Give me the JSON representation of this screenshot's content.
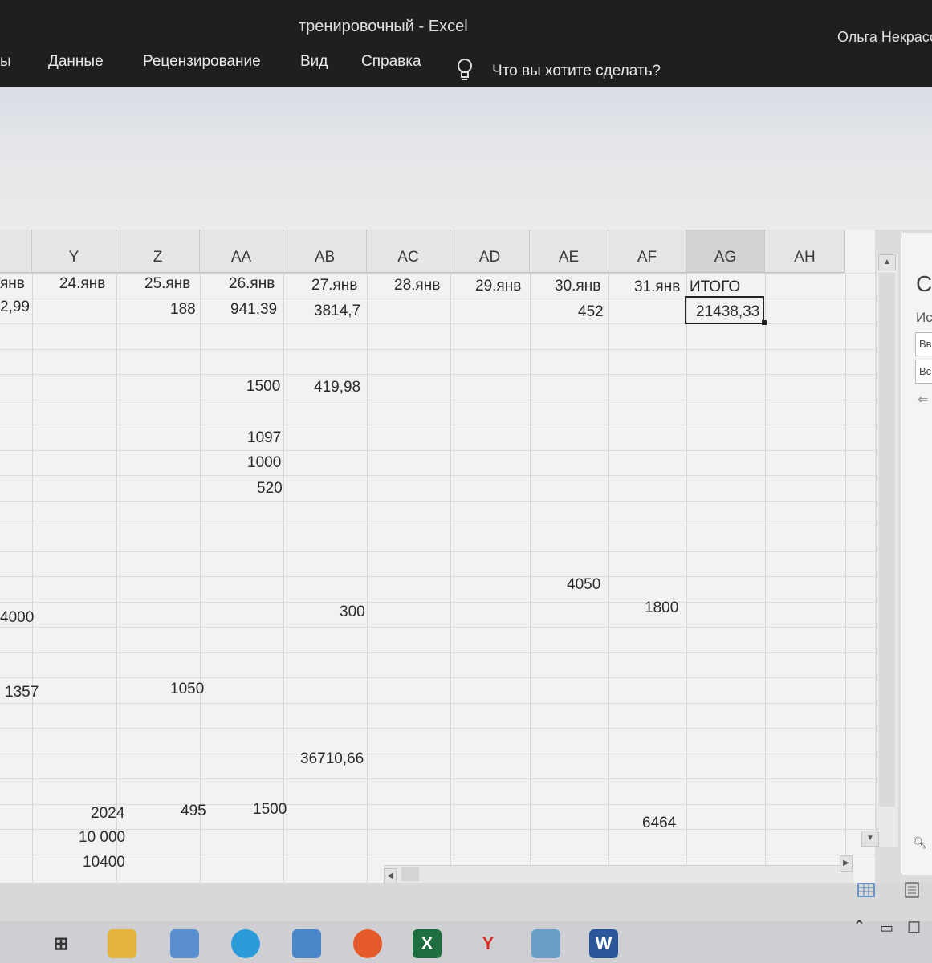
{
  "window": {
    "title": "тренировочный - Excel",
    "user": "Ольга Некрасо"
  },
  "ribbon_tabs": [
    {
      "label": "ы"
    },
    {
      "label": "Данные"
    },
    {
      "label": "Рецензирование"
    },
    {
      "label": "Вид"
    },
    {
      "label": "Справка"
    }
  ],
  "tell_me": {
    "icon": "lightbulb-icon",
    "placeholder": "Что вы хотите сделать?"
  },
  "columns": [
    "Y",
    "Z",
    "AA",
    "AB",
    "AC",
    "AD",
    "AE",
    "AF",
    "AG",
    "AH"
  ],
  "selected_column": "AG",
  "header_row": {
    "partial": "янв",
    "Y": "24.янв",
    "Z": "25.янв",
    "AA": "26.янв",
    "AB": "27.янв",
    "AC": "28.янв",
    "AD": "29.янв",
    "AE": "30.янв",
    "AF": "31.янв",
    "AG": "ИТОГО"
  },
  "row1": {
    "partial": "2,99",
    "Z": "188",
    "AA": "941,39",
    "AB": "3814,7",
    "AE": "452",
    "AG": "21438,33"
  },
  "cells": {
    "aa_1500": "1500",
    "ab_41998": "419,98",
    "aa_1097": "1097",
    "aa_1000": "1000",
    "aa_520": "520",
    "ae_4050": "4050",
    "partial_4000": "4000",
    "ab_300": "300",
    "af_1800": "1800",
    "partial_1357": "1357",
    "z_1050": "1050",
    "ab_3671066": "36710,66",
    "y_2024": "2024",
    "z_495": "495",
    "aa_1500b": "1500",
    "af_6464": "6464",
    "y_10000": "10 000",
    "y_10400": "10400"
  },
  "sidepane": {
    "title_partial": "С",
    "sub_partial": "Ис",
    "box1": "Вв",
    "box2": "Вс"
  },
  "colors": {
    "titlebar": "#1f1f1f",
    "excel_green": "#1d6f42",
    "word_blue": "#2b579a"
  }
}
